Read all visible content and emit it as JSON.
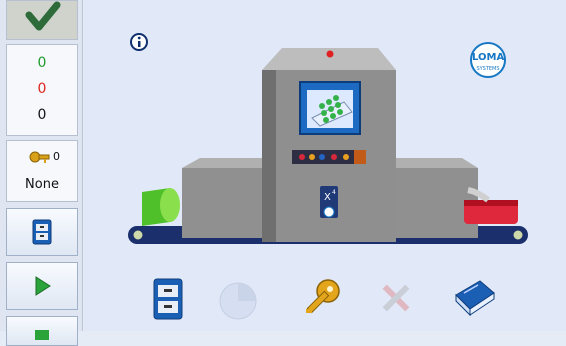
{
  "status": {
    "green_count": "0",
    "red_count": "0",
    "black_count": "0"
  },
  "user": {
    "key_count": "0",
    "level": "None"
  },
  "brand": {
    "logo_text": "LOMA",
    "logo_sub": "SYSTEMS"
  },
  "machine": {
    "badge_text": "X",
    "badge_sup": "4"
  },
  "colors": {
    "sidebar_bg": "#dfe6f1",
    "main_bg": "#e1e8f8",
    "accept_green": "#2e7d32",
    "reject_red": "#e53935"
  },
  "icons": [
    "accept-check-icon",
    "key-icon",
    "file-cabinet-icon",
    "play-icon",
    "info-icon",
    "pie-chart-icon",
    "wrench-screwdriver-icon",
    "manual-book-icon"
  ]
}
